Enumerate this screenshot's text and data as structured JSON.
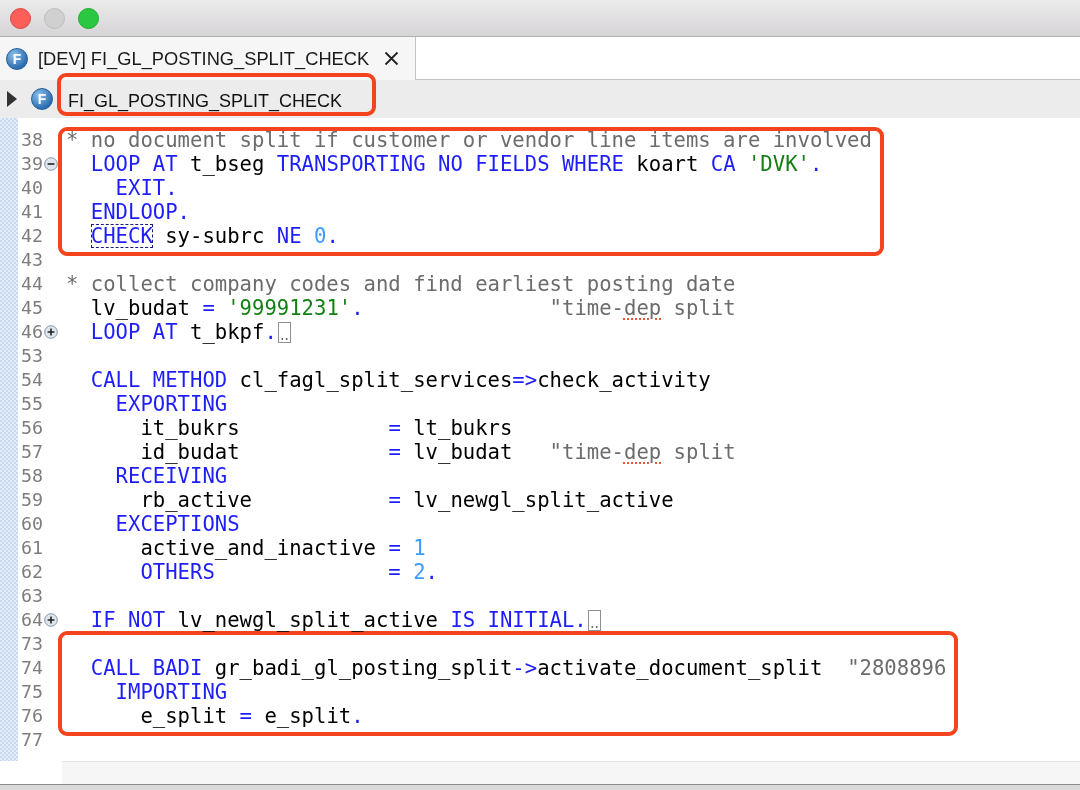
{
  "window": {
    "controls": [
      {
        "kind": "close",
        "disabled": false
      },
      {
        "kind": "minimize",
        "disabled": true
      },
      {
        "kind": "zoom",
        "disabled": false
      }
    ]
  },
  "tabs": [
    {
      "icon_letter": "F",
      "label": "[DEV] FI_GL_POSTING_SPLIT_CHECK",
      "selected": true
    }
  ],
  "breadcrumb": {
    "expanded": false,
    "icon_letter": "F",
    "label": "FI_GL_POSTING_SPLIT_CHECK",
    "annotated": true
  },
  "editor": {
    "sections": [
      {
        "annotated": true,
        "lines": [
          {
            "number": "38",
            "tokens": [
              {
                "kind": "comment",
                "text": "* no document split if customer or vendor line items are involved"
              }
            ]
          },
          {
            "number": "39",
            "folded": false,
            "tokens": [
              {
                "kind": "keyword",
                "text": "  LOOP AT"
              },
              {
                "kind": "plain",
                "text": " t_bseg "
              },
              {
                "kind": "keyword",
                "text": "TRANSPORTING NO FIELDS WHERE"
              },
              {
                "kind": "plain",
                "text": " koart "
              },
              {
                "kind": "keyword",
                "text": "CA "
              },
              {
                "kind": "string",
                "text": "'DVK'"
              },
              {
                "kind": "keyword",
                "text": "."
              }
            ]
          },
          {
            "number": "40",
            "tokens": [
              {
                "kind": "keyword",
                "text": "    EXIT."
              }
            ]
          },
          {
            "number": "41",
            "tokens": [
              {
                "kind": "keyword",
                "text": "  ENDLOOP."
              }
            ]
          },
          {
            "number": "42",
            "tokens": [
              {
                "kind": "keyword",
                "text": "  CHECK",
                "outlined": true
              },
              {
                "kind": "plain",
                "text": " sy-subrc "
              },
              {
                "kind": "keyword",
                "text": "NE "
              },
              {
                "kind": "number",
                "text": "0"
              },
              {
                "kind": "keyword",
                "text": "."
              }
            ]
          }
        ]
      },
      {
        "annotated": false,
        "lines": [
          {
            "number": "43"
          },
          {
            "number": "44",
            "tokens": [
              {
                "kind": "comment",
                "text": "* collect company codes and find earliest posting date"
              }
            ]
          },
          {
            "number": "45",
            "tokens": [
              {
                "kind": "plain",
                "text": "  lv_budat "
              },
              {
                "kind": "keyword",
                "text": "= "
              },
              {
                "kind": "string",
                "text": "'99991231'"
              },
              {
                "kind": "keyword",
                "text": "."
              },
              {
                "kind": "comment",
                "text": "               \"time-"
              },
              {
                "kind": "comment",
                "text": "dep",
                "misspelled": true
              },
              {
                "kind": "comment",
                "text": " split"
              }
            ]
          },
          {
            "number": "46",
            "folded": true,
            "tokens": [
              {
                "kind": "keyword",
                "text": "  LOOP AT"
              },
              {
                "kind": "plain",
                "text": " t_bkpf"
              },
              {
                "kind": "keyword",
                "text": "."
              }
            ]
          },
          {
            "number": "53"
          },
          {
            "number": "54",
            "tokens": [
              {
                "kind": "keyword",
                "text": "  CALL METHOD"
              },
              {
                "kind": "plain",
                "text": " cl_fagl_split_services"
              },
              {
                "kind": "keyword",
                "text": "=>"
              },
              {
                "kind": "plain",
                "text": "check_activity"
              }
            ]
          },
          {
            "number": "55",
            "tokens": [
              {
                "kind": "keyword",
                "text": "    EXPORTING"
              }
            ]
          },
          {
            "number": "56",
            "tokens": [
              {
                "kind": "plain",
                "text": "      it_bukrs            "
              },
              {
                "kind": "keyword",
                "text": "="
              },
              {
                "kind": "plain",
                "text": " lt_bukrs"
              }
            ]
          },
          {
            "number": "57",
            "tokens": [
              {
                "kind": "plain",
                "text": "      id_budat            "
              },
              {
                "kind": "keyword",
                "text": "="
              },
              {
                "kind": "plain",
                "text": " lv_budat   "
              },
              {
                "kind": "comment",
                "text": "\"time-"
              },
              {
                "kind": "comment",
                "text": "dep",
                "misspelled": true
              },
              {
                "kind": "comment",
                "text": " split"
              }
            ]
          },
          {
            "number": "58",
            "tokens": [
              {
                "kind": "keyword",
                "text": "    RECEIVING"
              }
            ]
          },
          {
            "number": "59",
            "tokens": [
              {
                "kind": "plain",
                "text": "      rb_active           "
              },
              {
                "kind": "keyword",
                "text": "="
              },
              {
                "kind": "plain",
                "text": " lv_newgl_split_active"
              }
            ]
          },
          {
            "number": "60",
            "tokens": [
              {
                "kind": "keyword",
                "text": "    EXCEPTIONS"
              }
            ]
          },
          {
            "number": "61",
            "tokens": [
              {
                "kind": "plain",
                "text": "      active_and_inactive "
              },
              {
                "kind": "keyword",
                "text": "= "
              },
              {
                "kind": "number",
                "text": "1"
              }
            ]
          },
          {
            "number": "62",
            "tokens": [
              {
                "kind": "keyword",
                "text": "      OTHERS              = "
              },
              {
                "kind": "number",
                "text": "2"
              },
              {
                "kind": "keyword",
                "text": "."
              }
            ]
          },
          {
            "number": "63"
          },
          {
            "number": "64",
            "folded": true,
            "tokens": [
              {
                "kind": "keyword",
                "text": "  IF NOT"
              },
              {
                "kind": "plain",
                "text": " lv_newgl_split_active "
              },
              {
                "kind": "keyword",
                "text": "IS INITIAL."
              }
            ]
          }
        ]
      },
      {
        "annotated": true,
        "lines": [
          {
            "number": "73"
          },
          {
            "number": "74",
            "tokens": [
              {
                "kind": "keyword",
                "text": "  CALL BADI"
              },
              {
                "kind": "plain",
                "text": " gr_badi_gl_posting_split"
              },
              {
                "kind": "keyword",
                "text": "->"
              },
              {
                "kind": "plain",
                "text": "activate_document_split  "
              },
              {
                "kind": "comment",
                "text": "\"2808896"
              }
            ]
          },
          {
            "number": "75",
            "tokens": [
              {
                "kind": "keyword",
                "text": "    IMPORTING"
              }
            ]
          },
          {
            "number": "76",
            "tokens": [
              {
                "kind": "plain",
                "text": "      e_split "
              },
              {
                "kind": "keyword",
                "text": "="
              },
              {
                "kind": "plain",
                "text": " e_split"
              },
              {
                "kind": "keyword",
                "text": "."
              }
            ]
          }
        ]
      },
      {
        "annotated": false,
        "lines": [
          {
            "number": "77"
          }
        ]
      }
    ]
  }
}
